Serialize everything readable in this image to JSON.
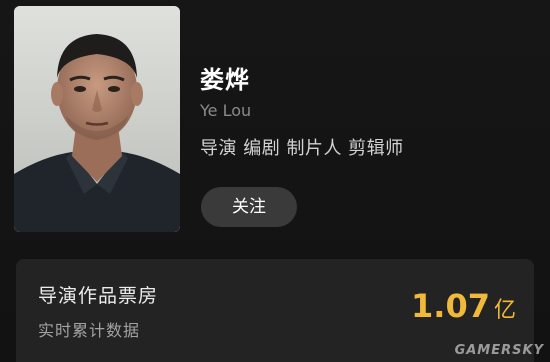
{
  "profile": {
    "name_cn": "娄烨",
    "name_en": "Ye Lou",
    "roles": "导演 编剧 制片人 剪辑师",
    "follow_label": "关注"
  },
  "box_office": {
    "title": "导演作品票房",
    "subtitle": "实时累计数据",
    "value": "1.07",
    "unit": "亿"
  },
  "watermark": "GAMERSKY",
  "colors": {
    "background": "#131313",
    "card": "#232323",
    "accent": "#f0b93a",
    "button": "#3a3a3a"
  }
}
